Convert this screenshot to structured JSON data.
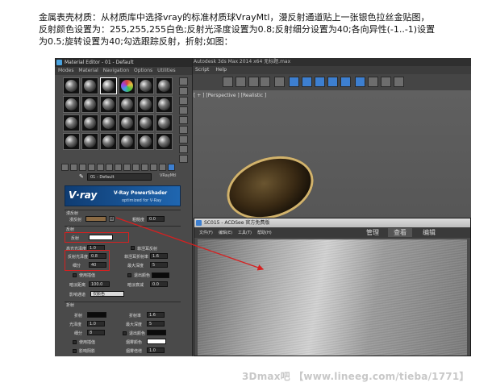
{
  "caption": {
    "line1": "金属表壳材质：从材质库中选择vray的标准材质球VrayMtl，漫反射通道贴上一张银色拉丝金贴图，",
    "line2": "反射颜色设置为：255,255,255白色;反射光泽度设置为0.8;反射细分设置为40;各向异性(-1..-1)设置",
    "line3": "为0.5;旋转设置为40;勾选跟踪反射，折射;如图："
  },
  "max_window": {
    "title": "Autodesk 3ds Max 2014 x64     无标题.max",
    "menu": [
      "Script",
      "Help"
    ],
    "viewport_label": "[ + ] [Perspective ] [Realistic ]"
  },
  "material_editor": {
    "title": "Material Editor - 01 - Default",
    "menu": [
      "Modes",
      "Material",
      "Navigation",
      "Options",
      "Utilities"
    ],
    "material_name": "01 - Default",
    "material_type": "VRayMtl",
    "banner": {
      "logo": "V·ray",
      "line1": "V-Ray PowerShader",
      "line2": "optimized for V-Ray"
    },
    "diffuse_section": {
      "header": "漫反射",
      "diffuse_label": "漫反射",
      "roughness_label": "粗糙度",
      "roughness_value": "0.0",
      "map_button": "M"
    },
    "reflection_section": {
      "header": "反射",
      "reflect_label": "反射",
      "glossiness_label": "反射光泽度",
      "glossiness_value": "0.8",
      "subdivs_label": "细分",
      "subdivs_value": "40",
      "fresnel_label": "菲涅耳反射",
      "max_depth_label": "最大深度",
      "max_depth_value": "5",
      "exit_color_label": "退出颜色",
      "hilight_label": "高光光泽度",
      "hilight_value": "1.0",
      "fresnel_ior_label": "菲涅耳折射率",
      "fresnel_ior_value": "1.6",
      "use_interp_label": "使用插值",
      "dim_distance_label": "暗淡距离",
      "dim_distance_value": "100.0",
      "dim_falloff_label": "暗淡衰减",
      "dim_falloff_value": "0.0",
      "affect_channels_label": "影响通道",
      "affect_channels_value": "仅颜色"
    },
    "refraction_section": {
      "header": "折射",
      "refract_label": "折射",
      "ior_label": "折射率",
      "ior_value": "1.6",
      "glossiness_label": "光泽度",
      "glossiness_value": "1.0",
      "max_depth_label": "最大深度",
      "max_depth_value": "5",
      "subdivs_label": "细分",
      "subdivs_value": "8",
      "exit_color_label": "退出颜色",
      "use_interp_label": "使用插值",
      "fog_color_label": "烟雾颜色",
      "affect_shadows_label": "影响阴影",
      "fog_multiplier_label": "烟雾倍增",
      "fog_multiplier_value": "1.0"
    }
  },
  "acdsee": {
    "title": "SC015 - ACDSee 官方免费版",
    "menu": [
      "文件(F)",
      "编辑(E)",
      "工具(T)",
      "帮助(H)"
    ],
    "tabs": [
      "管理",
      "查看",
      "编辑"
    ],
    "selected_tab": "查看"
  },
  "watermark": "3Dmax吧 【www.lineeg.com/tieba/1771】",
  "colors": {
    "annotation_red": "#d62020",
    "diffuse_swatch": "#8a6a44",
    "reflect_swatch": "#ffffff"
  }
}
